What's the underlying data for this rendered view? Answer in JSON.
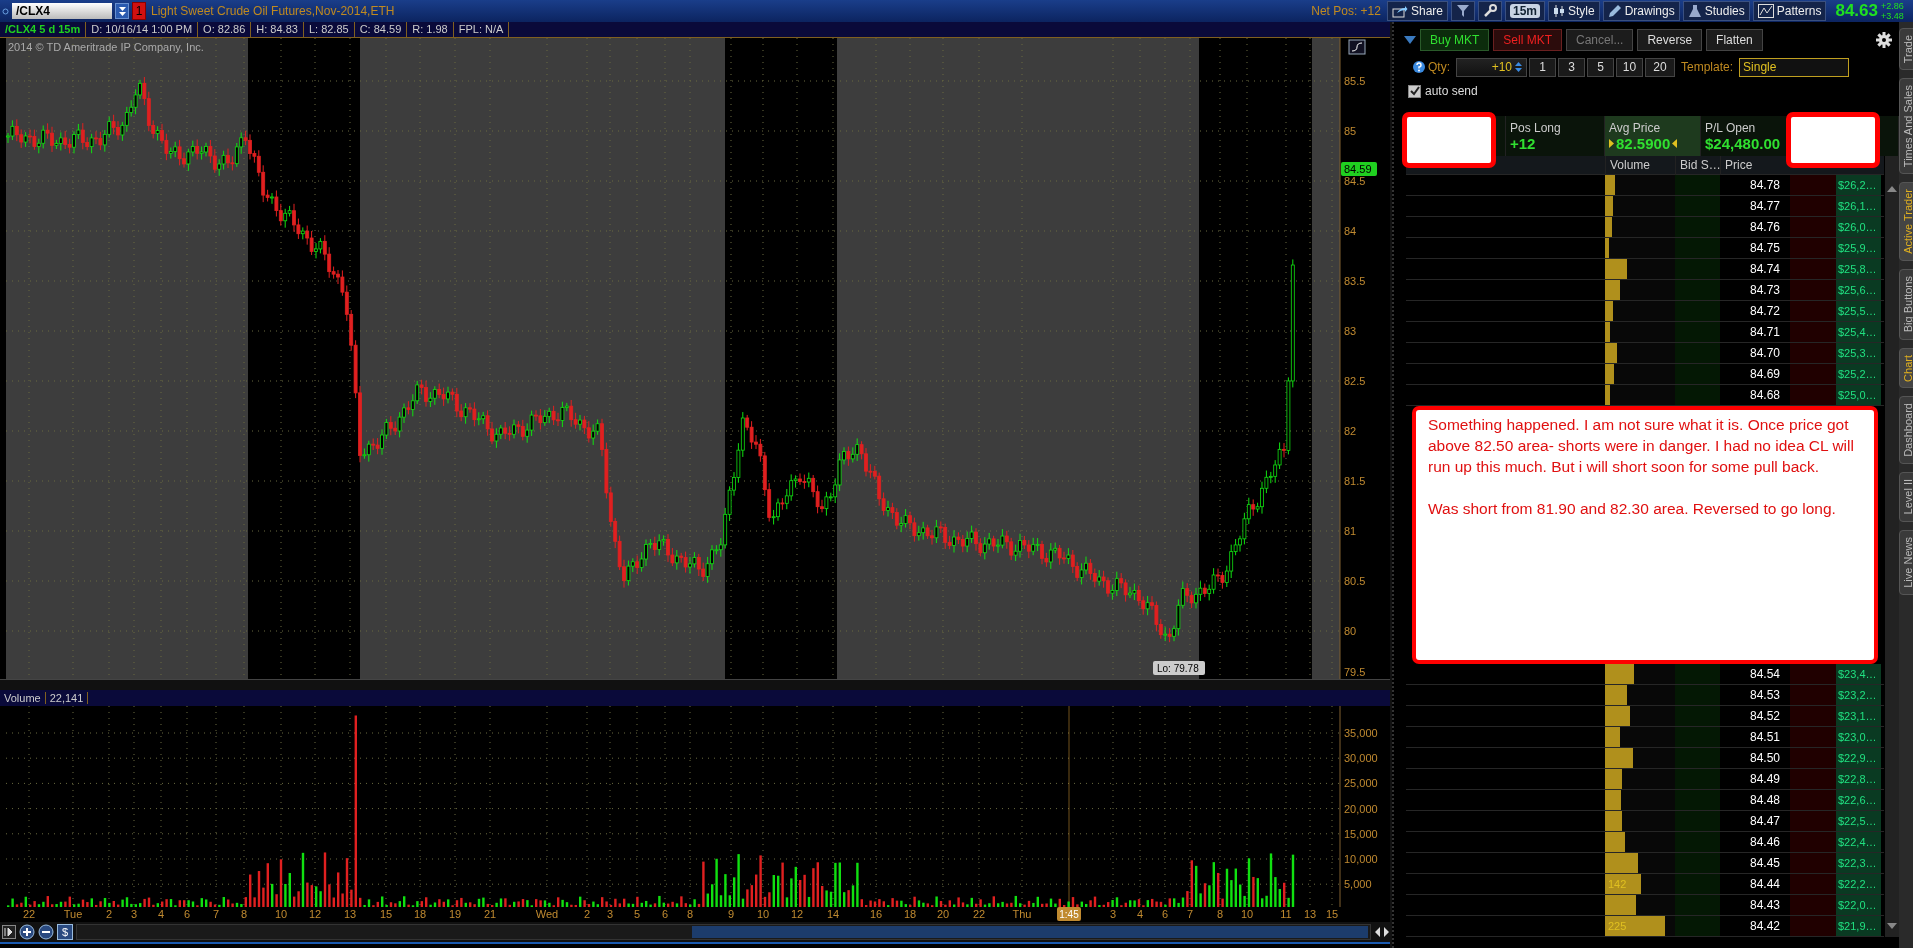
{
  "toolbar": {
    "symbol": "/CLX4",
    "link_badge": "1",
    "description": "Light Sweet Crude Oil Futures,Nov-2014,ETH",
    "net_pos": "Net Pos: +12",
    "buttons": [
      {
        "kind": "share",
        "label": "Share"
      },
      {
        "kind": "funnel"
      },
      {
        "kind": "wrench"
      },
      {
        "kind": "timeframe",
        "label": "15m"
      },
      {
        "kind": "style",
        "label": "Style"
      },
      {
        "kind": "drawings",
        "label": "Drawings"
      },
      {
        "kind": "studies",
        "label": "Studies"
      },
      {
        "kind": "patterns",
        "label": "Patterns"
      }
    ],
    "last": "84.63",
    "change": "+2.86",
    "change_pct": "+3.48"
  },
  "info_bar": {
    "study": "/CLX4 5 d 15m",
    "fields": [
      "D: 10/16/14 1:00 PM",
      "O: 82.86",
      "H: 84.83",
      "L: 82.85",
      "C: 84.59",
      "R: 1.98",
      "FPL: N/A"
    ]
  },
  "price_chart": {
    "copyright": "2014 © TD Ameritrade IP Company, Inc.",
    "y_labels": [
      "85.5",
      "85",
      "84.5",
      "84",
      "83.5",
      "83",
      "82.5",
      "82",
      "81.5",
      "81",
      "80.5",
      "80",
      "79.5"
    ],
    "last_badge": "84.59",
    "low_label": "Lo: 79.78"
  },
  "volume_chart": {
    "title": "Volume",
    "value": "22,141",
    "y_labels": [
      "35,000",
      "30,000",
      "25,000",
      "20,000",
      "15,000",
      "10,000",
      "5,000"
    ]
  },
  "time_axis": {
    "labels": [
      "22",
      "Tue",
      "2",
      "3",
      "4",
      "6",
      "7",
      "8",
      "10",
      "12",
      "13",
      "15",
      "18",
      "19",
      "21",
      "Wed",
      "2",
      "3",
      "5",
      "6",
      "8",
      "9",
      "10",
      "12",
      "14",
      "16",
      "18",
      "20",
      "22",
      "Thu",
      "3",
      "4",
      "6",
      "7",
      "8",
      "10",
      "11",
      "13",
      "15"
    ],
    "cursor": "1:45"
  },
  "bottom_bar": {
    "currency_button": "$"
  },
  "trader": {
    "order_buttons": [
      {
        "label": "Buy MKT",
        "kind": "buy",
        "disabled": false
      },
      {
        "label": "Sell MKT",
        "kind": "sell",
        "disabled": false
      },
      {
        "label": "Cancel...",
        "kind": "neutral",
        "disabled": true
      },
      {
        "label": "Reverse",
        "kind": "neutral",
        "disabled": false
      },
      {
        "label": "Flatten",
        "kind": "neutral",
        "disabled": false
      }
    ],
    "qty_label": "Qty:",
    "qty": "+10",
    "qty_presets": [
      "1",
      "3",
      "5",
      "10",
      "20"
    ],
    "template_label": "Template:",
    "template": "Single",
    "auto_send": {
      "label": "auto send",
      "checked": true
    },
    "position": [
      {
        "label": "Pos Long",
        "value": "+12",
        "highlighted": false
      },
      {
        "label": "Avg Price",
        "value": "82.5900",
        "highlighted": true
      },
      {
        "label": "P/L Open",
        "value": "$24,480.00",
        "highlighted": false
      }
    ],
    "ladder_columns": [
      "Volume",
      "Bid S…",
      "Price"
    ],
    "rows_above": [
      {
        "price": "84.78",
        "level": 0.14,
        "pl": "$26,2…"
      },
      {
        "price": "84.77",
        "level": 0.12,
        "pl": "$26,1…"
      },
      {
        "price": "84.76",
        "level": 0.1,
        "pl": "$26,0…"
      },
      {
        "price": "84.75",
        "level": 0.05,
        "pl": "$25,9…"
      },
      {
        "price": "84.74",
        "level": 0.31,
        "pl": "$25,8…"
      },
      {
        "price": "84.73",
        "level": 0.21,
        "pl": "$25,6…"
      },
      {
        "price": "84.72",
        "level": 0.12,
        "pl": "$25,5…"
      },
      {
        "price": "84.71",
        "level": 0.07,
        "pl": "$25,4…"
      },
      {
        "price": "84.70",
        "level": 0.17,
        "pl": "$25,3…"
      },
      {
        "price": "84.69",
        "level": 0.13,
        "pl": "$25,2…"
      },
      {
        "price": "84.68",
        "level": 0.07,
        "pl": "$25,0…"
      }
    ],
    "note": {
      "paragraphs": [
        "Something happened. I am not sure what it is. Once price got above 82.50 area- shorts were in danger. I had no idea CL will run up this much. But i will short soon for some pull back.",
        "Was short from 81.90 and 82.30 area. Reversed to go long."
      ]
    },
    "rows_below": [
      {
        "price": "84.54",
        "level": 0.42,
        "pl": "$23,4…"
      },
      {
        "price": "84.53",
        "level": 0.31,
        "pl": "$23,2…"
      },
      {
        "price": "84.52",
        "level": 0.35,
        "pl": "$23,1…"
      },
      {
        "price": "84.51",
        "level": 0.21,
        "pl": "$23,0…"
      },
      {
        "price": "84.50",
        "level": 0.4,
        "pl": "$22,9…"
      },
      {
        "price": "84.49",
        "level": 0.24,
        "pl": "$22,8…"
      },
      {
        "price": "84.48",
        "level": 0.23,
        "pl": "$22,6…"
      },
      {
        "price": "84.47",
        "level": 0.24,
        "pl": "$22,5…"
      },
      {
        "price": "84.46",
        "level": 0.28,
        "pl": "$22,4…"
      },
      {
        "price": "84.45",
        "level": 0.47,
        "pl": "$22,3…"
      },
      {
        "price": "84.44",
        "level": 0.52,
        "volume": "142",
        "pl": "$22,2…"
      },
      {
        "price": "84.43",
        "level": 0.44,
        "pl": "$22,0…"
      },
      {
        "price": "84.42",
        "level": 0.85,
        "volume": "225",
        "pl": "$21,9…"
      }
    ]
  },
  "side_tabs": [
    {
      "label": "Trade",
      "selected": false
    },
    {
      "label": "Times And Sales",
      "selected": false
    },
    {
      "label": "Active Trader",
      "selected": true
    },
    {
      "label": "Big Buttons",
      "selected": false
    },
    {
      "label": "Chart",
      "selected": true
    },
    {
      "label": "Dashboard",
      "selected": false
    },
    {
      "label": "Level II",
      "selected": false
    },
    {
      "label": "Live News",
      "selected": false
    }
  ]
}
